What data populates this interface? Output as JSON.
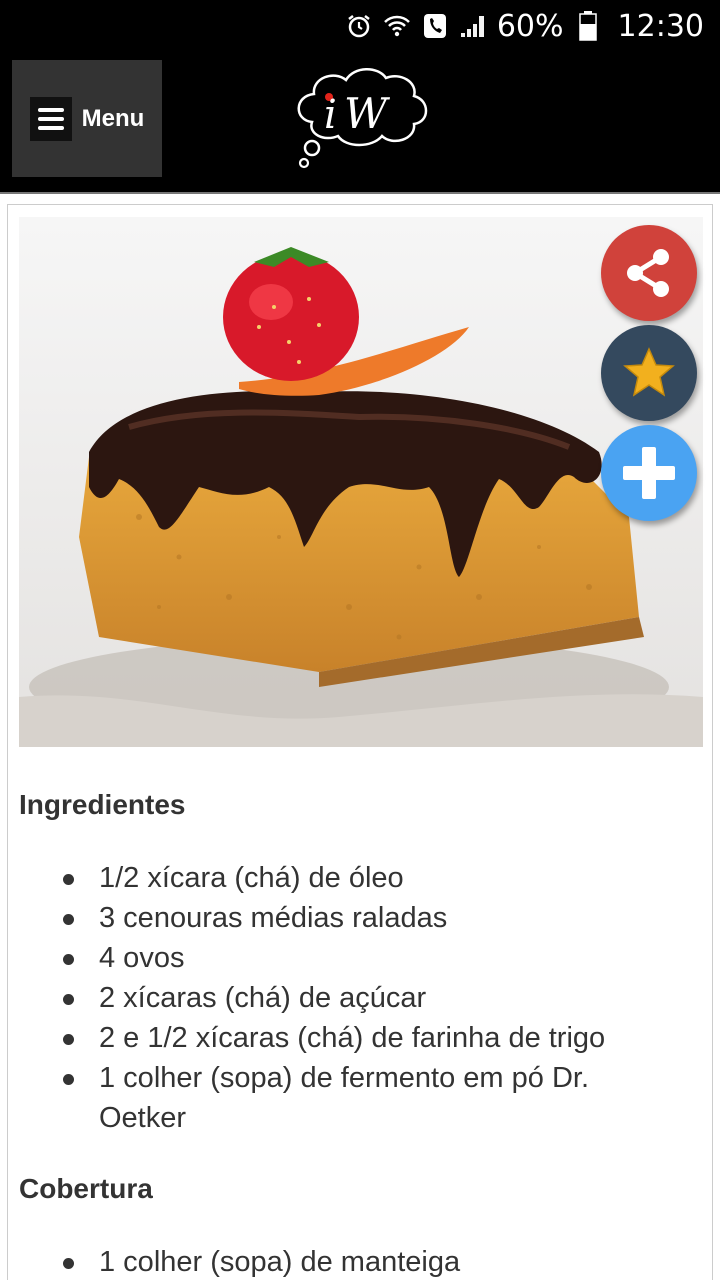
{
  "status_bar": {
    "battery_percent": "60%",
    "time": "12:30",
    "icons": [
      "alarm-icon",
      "wifi-icon",
      "phone-call-icon",
      "signal-icon",
      "battery-icon"
    ]
  },
  "header": {
    "menu_label": "Menu",
    "logo_text": "iW",
    "logo_icon": "thought-bubble-logo"
  },
  "actions": {
    "share_icon": "share-icon",
    "favorite_icon": "star-icon",
    "add_icon": "plus-icon",
    "colors": {
      "share": "#d0423b",
      "favorite": "#34495e",
      "add": "#4aa3f2",
      "star": "#f2b01e"
    }
  },
  "recipe": {
    "sections": [
      {
        "title": "Ingredientes",
        "items": [
          "1/2 xícara (chá) de óleo",
          "3 cenouras médias raladas",
          "4 ovos",
          "2 xícaras (chá) de açúcar",
          "2 e 1/2 xícaras (chá) de farinha de trigo",
          "1 colher (sopa) de fermento em pó Dr. Oetker"
        ]
      },
      {
        "title": "Cobertura",
        "items": [
          "1 colher (sopa) de manteiga"
        ]
      }
    ]
  }
}
